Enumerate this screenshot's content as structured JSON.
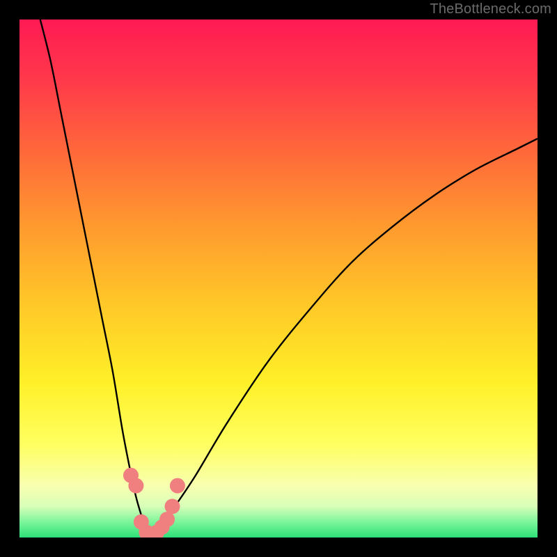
{
  "watermark": "TheBottleneck.com",
  "chart_data": {
    "type": "line",
    "title": "",
    "xlabel": "",
    "ylabel": "",
    "xlim": [
      0,
      100
    ],
    "ylim": [
      0,
      100
    ],
    "series": [
      {
        "name": "bottleneck-curve",
        "x": [
          4,
          6,
          8,
          10,
          12,
          14,
          16,
          18,
          20,
          22,
          23,
          24,
          25,
          26,
          27,
          28,
          30,
          34,
          40,
          48,
          56,
          64,
          72,
          80,
          88,
          96,
          100
        ],
        "y": [
          100,
          92,
          82,
          72,
          62,
          52,
          42,
          32,
          20,
          10,
          6,
          3,
          1,
          0,
          1,
          3,
          6,
          12,
          22,
          34,
          44,
          53,
          60,
          66,
          71,
          75,
          77
        ]
      }
    ],
    "markers": {
      "name": "highlighted-points",
      "color": "#f08080",
      "points": [
        {
          "x": 21.5,
          "y": 12
        },
        {
          "x": 22.5,
          "y": 10
        },
        {
          "x": 23.5,
          "y": 3
        },
        {
          "x": 24.5,
          "y": 1
        },
        {
          "x": 25.5,
          "y": 0.5
        },
        {
          "x": 26.5,
          "y": 1
        },
        {
          "x": 27.5,
          "y": 2
        },
        {
          "x": 28.5,
          "y": 3.5
        },
        {
          "x": 29.5,
          "y": 6
        },
        {
          "x": 30.5,
          "y": 10
        }
      ]
    },
    "gradient_stops": [
      {
        "pos": 0,
        "color": "#ff1a53"
      },
      {
        "pos": 12,
        "color": "#ff3a4a"
      },
      {
        "pos": 26,
        "color": "#ff6a3a"
      },
      {
        "pos": 40,
        "color": "#ff9a2e"
      },
      {
        "pos": 55,
        "color": "#ffc828"
      },
      {
        "pos": 70,
        "color": "#fff028"
      },
      {
        "pos": 82,
        "color": "#ffff60"
      },
      {
        "pos": 90,
        "color": "#f8ffb0"
      },
      {
        "pos": 94,
        "color": "#d8ffb8"
      },
      {
        "pos": 97,
        "color": "#7cf59a"
      },
      {
        "pos": 100,
        "color": "#2de07a"
      }
    ]
  }
}
